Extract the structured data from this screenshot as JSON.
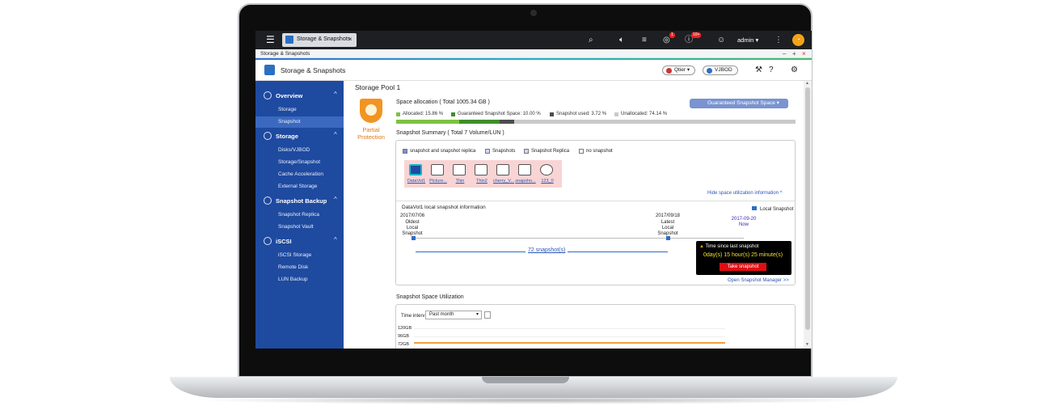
{
  "topbar": {
    "task_label": "Storage & Snapshots",
    "notif_badge_1": "1",
    "notif_badge_2": "10+",
    "user": "admin"
  },
  "window": {
    "title": "Storage & Snapshots",
    "controls": [
      "–",
      "+",
      "×"
    ]
  },
  "app": {
    "title": "Storage & Snapshots",
    "qtier": "Qtier",
    "vjbod": "VJBOD"
  },
  "sidebar": {
    "groups": [
      {
        "label": "Overview",
        "items": [
          "Storage",
          "Snapshot"
        ]
      },
      {
        "label": "Storage",
        "items": [
          "Disks/VJBOD",
          "Storage/Snapshot",
          "Cache Acceleration",
          "External Storage"
        ]
      },
      {
        "label": "Snapshot Backup",
        "items": [
          "Snapshot Replica",
          "Snapshot Vault"
        ]
      },
      {
        "label": "iSCSI",
        "items": [
          "iSCSI Storage",
          "Remote Disk",
          "LUN Backup"
        ]
      }
    ],
    "active_item": "Snapshot"
  },
  "pool": {
    "title": "Storage Pool 1",
    "status": "Partial Protection",
    "space_title": "Space allocation ( Total 1005.34 GB )",
    "legend": [
      {
        "label": "Allocated: 15.86 %",
        "color": "#7cc242"
      },
      {
        "label": "Guaranteed Snapshot Space: 10.00 %",
        "color": "#3e8e2a"
      },
      {
        "label": "Snapshot used: 3.72 %",
        "color": "#4d4d4d"
      },
      {
        "label": "Unallocated: 74.14 %",
        "color": "#c9c9c9"
      }
    ],
    "guaranteed_button": "Guaranteed Snapshot Space",
    "allocated_pct": 15.86,
    "guaranteed_pct": 10.0,
    "snapshot_used_pct": 3.72,
    "unallocated_pct": 74.14
  },
  "summary": {
    "title": "Snapshot Summary ( Total 7 Volume/LUN )",
    "legend": [
      "snapshot and snapshot replica",
      "Snapshots",
      "Snapshot Replica",
      "no snapshot"
    ],
    "volumes": [
      "DataVol1",
      "Picture...",
      "Thin",
      "Thin2",
      "cherry_V...",
      "snapsho...",
      "123_0"
    ],
    "hide_link": "Hide space utilization information"
  },
  "local": {
    "title": "DataVol1 local snapshot information",
    "legend": "Local Snapshot",
    "oldest_date": "2017/07/06",
    "oldest_label": "Oldest Local Snapshot",
    "latest_date": "2017/09/18",
    "latest_label": "Latest Local Snapshot",
    "now_date": "2017-09-20",
    "now_label": "Now",
    "count": "72 snapshot(s)",
    "popup_title": "Time since last snapshot",
    "popup_time": "0day(s) 15 hour(s) 25 minute(s)",
    "take_snapshot": "Take snapshot",
    "open_manager": "Open Snapshot Manager >>"
  },
  "util": {
    "title": "Snapshot Space Utilization",
    "time_label": "Time interv",
    "select_value": "Past month",
    "y_labels": [
      "120GB",
      "96GB",
      "72GB"
    ]
  }
}
